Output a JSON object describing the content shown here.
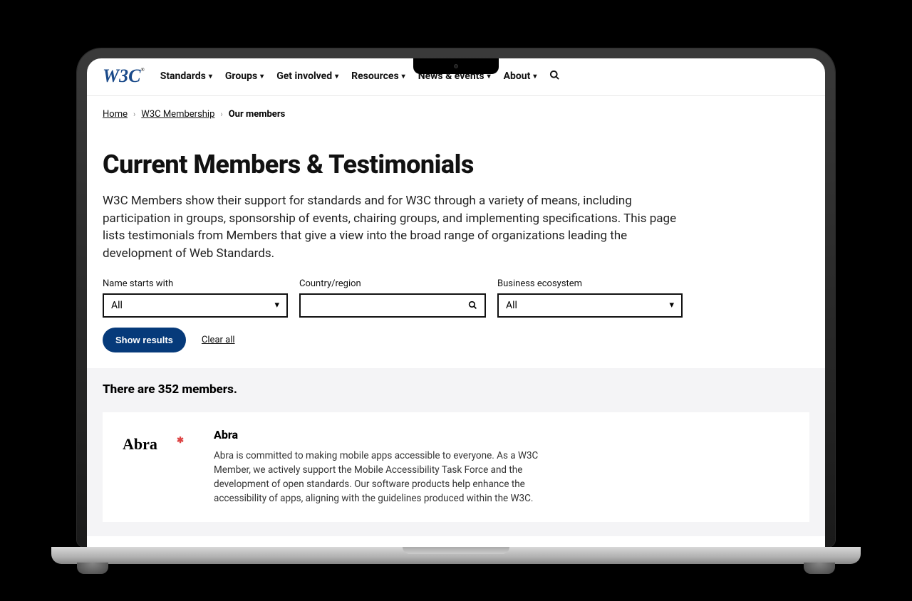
{
  "logo_text": "W3C",
  "logo_reg": "®",
  "nav": [
    {
      "label": "Standards"
    },
    {
      "label": "Groups"
    },
    {
      "label": "Get involved"
    },
    {
      "label": "Resources"
    },
    {
      "label": "News & events"
    },
    {
      "label": "About"
    }
  ],
  "breadcrumb": {
    "home": "Home",
    "membership": "W3C Membership",
    "current": "Our members"
  },
  "page_title": "Current Members & Testimonials",
  "intro": "W3C Members show their support for standards and for W3C through a variety of means, including participation in groups, sponsorship of events, chairing groups, and implementing specifications. This page lists testimonials from Members that give a view into the broad range of organizations leading the development of Web Standards.",
  "filters": {
    "name_starts": {
      "label": "Name starts with",
      "value": "All"
    },
    "country": {
      "label": "Country/region",
      "value": ""
    },
    "ecosystem": {
      "label": "Business ecosystem",
      "value": "All"
    }
  },
  "show_results": "Show results",
  "clear_all": "Clear all",
  "results_count": "There are 352 members.",
  "member": {
    "logo_text": "Abra",
    "name": "Abra",
    "desc": "Abra is committed to making mobile apps accessible to everyone. As a W3C Member, we actively support the Mobile Accessibility Task Force and the development of open standards. Our software products help enhance the accessibility of apps, aligning with the guidelines produced within the W3C."
  }
}
